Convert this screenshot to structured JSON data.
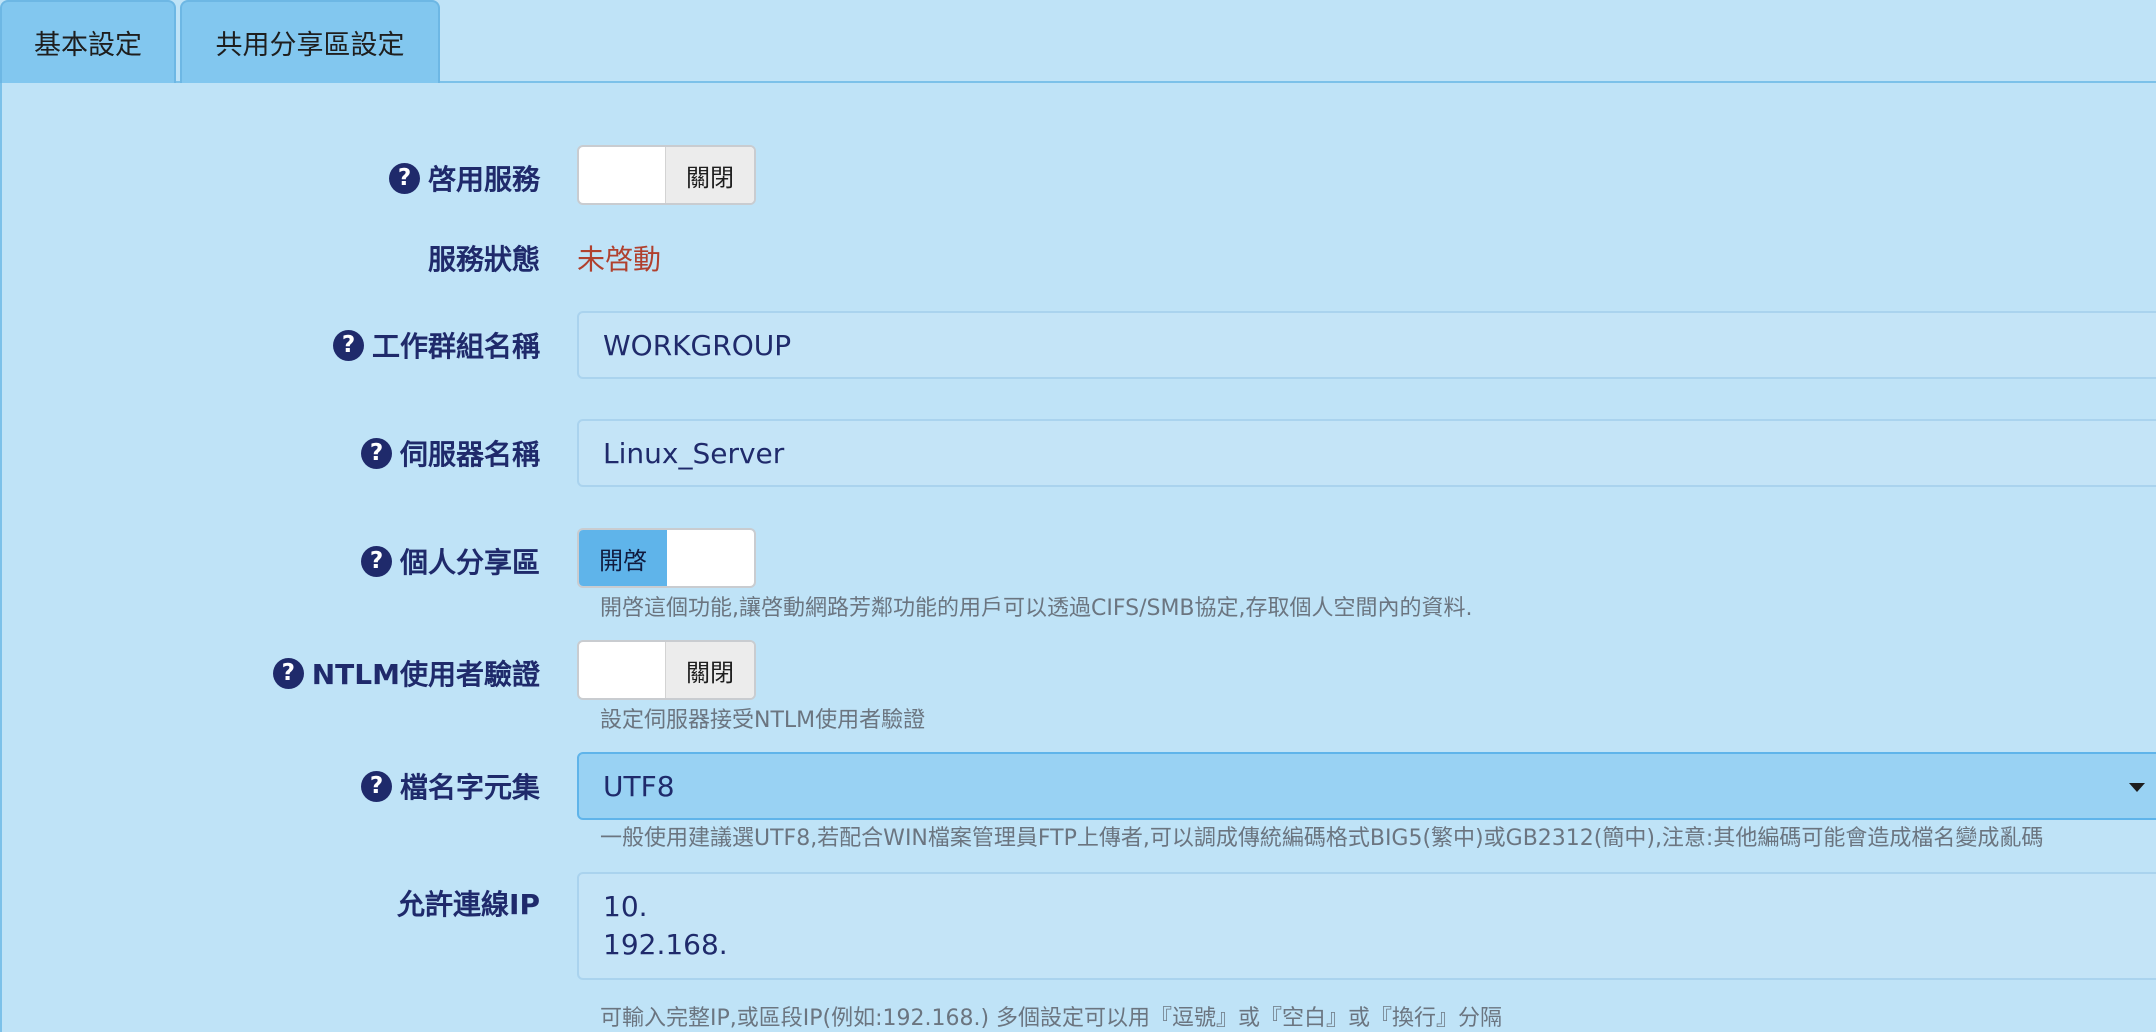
{
  "tabs": [
    {
      "label": "基本設定"
    },
    {
      "label": "共用分享區設定"
    }
  ],
  "form": {
    "enable_service": {
      "label": "啓用服務",
      "toggle_text": "關閉",
      "state": "off"
    },
    "service_status": {
      "label": "服務狀態",
      "value": "未啓動",
      "color": "#b0402e"
    },
    "workgroup": {
      "label": "工作群組名稱",
      "value": "WORKGROUP"
    },
    "server_name": {
      "label": "伺服器名稱",
      "value": "Linux_Server"
    },
    "personal_share": {
      "label": "個人分享區",
      "toggle_text": "開啓",
      "state": "on",
      "hint": "開啓這個功能,讓啓動網路芳鄰功能的用戶可以透過CIFS/SMB協定,存取個人空間內的資料."
    },
    "ntlm_auth": {
      "label": "NTLM使用者驗證",
      "toggle_text": "關閉",
      "state": "off",
      "hint": "設定伺服器接受NTLM使用者驗證"
    },
    "charset": {
      "label": "檔名字元集",
      "value": "UTF8",
      "hint": "一般使用建議選UTF8,若配合WIN檔案管理員FTP上傳者,可以調成傳統編碼格式BIG5(繁中)或GB2312(簡中),注意:其他編碼可能會造成檔名變成亂碼"
    },
    "allowed_ip": {
      "label": "允許連線IP",
      "lines": [
        "10.",
        "192.168."
      ],
      "hint": "可輸入完整IP,或區段IP(例如:192.168.) 多個設定可以用『逗號』或『空白』或『換行』分隔"
    }
  },
  "icons": {
    "help": "question-circle-icon",
    "select_caret": "caret-down-icon"
  },
  "colors": {
    "background": "#bfe3f7",
    "tab": "#82c7ef",
    "label": "#1f2a6b",
    "toggle_on": "#5fb4ea",
    "status_stopped": "#b0402e"
  }
}
